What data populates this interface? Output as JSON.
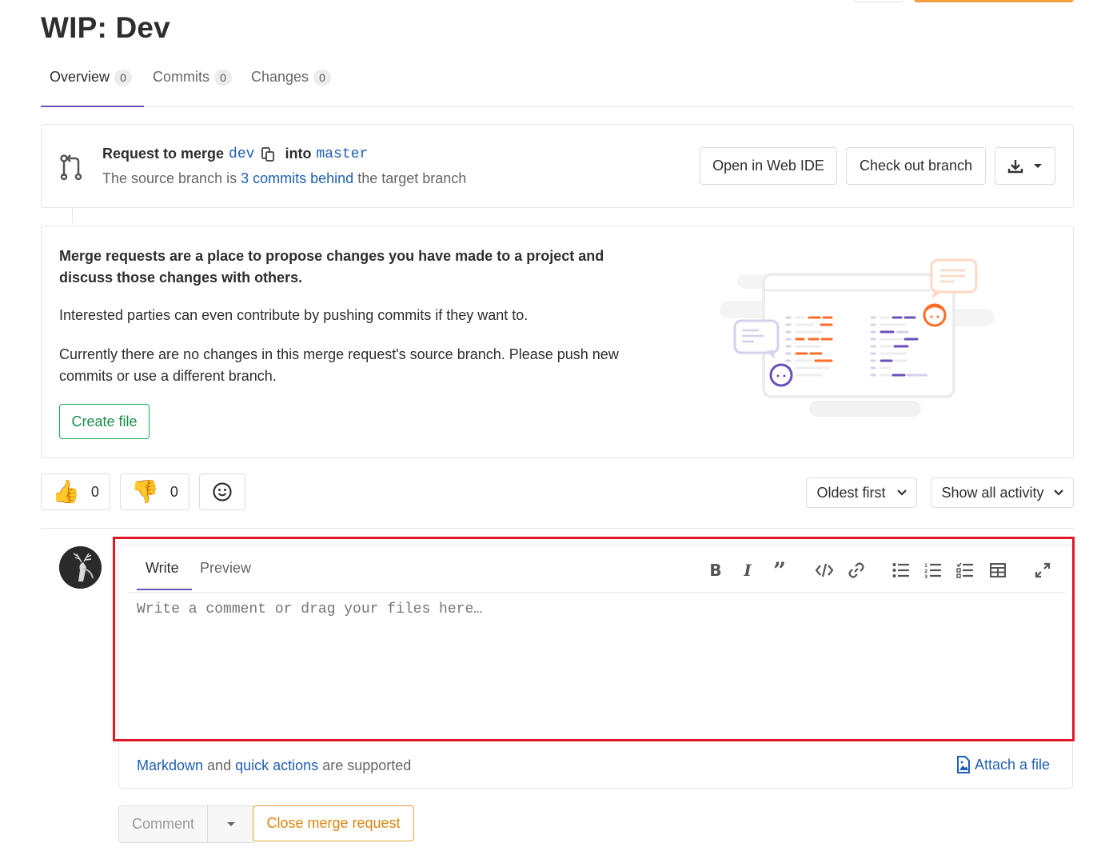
{
  "page": {
    "title": "WIP: Dev"
  },
  "tabs": [
    {
      "label": "Overview",
      "count": "0"
    },
    {
      "label": "Commits",
      "count": "0"
    },
    {
      "label": "Changes",
      "count": "0"
    }
  ],
  "merge_info": {
    "request_text": "Request to merge",
    "source_branch": "dev",
    "into_text": "into",
    "target_branch": "master",
    "status_prefix": "The source branch is",
    "status_link": "3 commits behind",
    "status_suffix": "the target branch",
    "open_web_ide": "Open in Web IDE",
    "check_out_branch": "Check out branch"
  },
  "empty_state": {
    "para1": "Merge requests are a place to propose changes you have made to a project and discuss those changes with others.",
    "para2": "Interested parties can even contribute by pushing commits if they want to.",
    "para3": "Currently there are no changes in this merge request's source branch. Please push new commits or use a different branch.",
    "create_file": "Create file"
  },
  "awards": {
    "thumbs_up_count": "0",
    "thumbs_down_count": "0"
  },
  "sort": {
    "order": "Oldest first",
    "filter": "Show all activity"
  },
  "editor": {
    "tab_write": "Write",
    "tab_preview": "Preview",
    "placeholder": "Write a comment or drag your files here…",
    "footer_markdown": "Markdown",
    "footer_and": "and",
    "footer_quick_actions": "quick actions",
    "footer_supported": "are supported",
    "attach_file": "Attach a file"
  },
  "actions": {
    "comment": "Comment",
    "close_mr": "Close merge request"
  },
  "colors": {
    "accent": "#6b4fbb",
    "link": "#1f5fb3",
    "success": "#1aaa55",
    "warning": "#d8860f",
    "highlight": "#e2172a"
  }
}
